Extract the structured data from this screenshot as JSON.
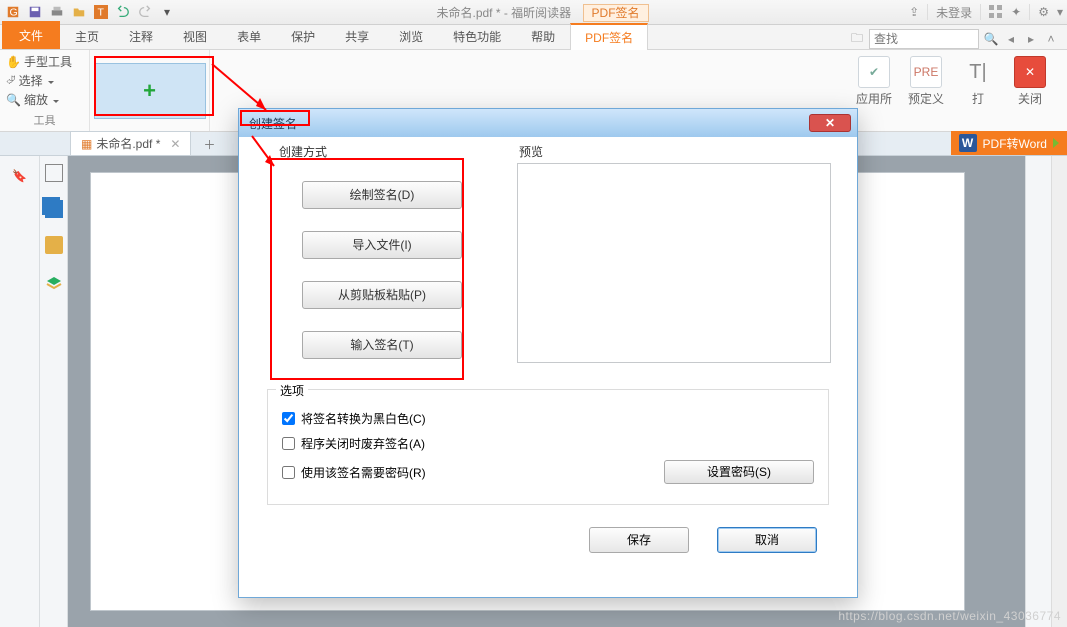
{
  "titlebar": {
    "doc_title": "未命名.pdf * - 福昕阅读器",
    "ribbon_context_label": "PDF签名",
    "login_label": "未登录"
  },
  "ribbon": {
    "file": "文件",
    "tabs": [
      "主页",
      "注释",
      "视图",
      "表单",
      "保护",
      "共享",
      "浏览",
      "特色功能",
      "帮助",
      "PDF签名"
    ],
    "search_placeholder": "查找",
    "tools_group": {
      "hand": "手型工具",
      "select": "选择",
      "zoom": "缩放",
      "group_label": "工具"
    },
    "sign_group": {
      "apply": "应用所",
      "predef": "预定义",
      "type": "打",
      "close": "关闭"
    }
  },
  "doctab": {
    "name": "未命名.pdf *",
    "pdf2word": "PDF转Word"
  },
  "dialog": {
    "title": "创建签名",
    "create_section": "创建方式",
    "preview_section": "预览",
    "btn_draw": "绘制签名(D)",
    "btn_import": "导入文件(I)",
    "btn_paste": "从剪贴板粘贴(P)",
    "btn_type": "输入签名(T)",
    "options_section": "选项",
    "opt_bw": "将签名转换为黑白色(C)",
    "opt_discard": "程序关闭时废弃签名(A)",
    "opt_password": "使用该签名需要密码(R)",
    "btn_setpw": "设置密码(S)",
    "btn_save": "保存",
    "btn_cancel": "取消"
  },
  "watermark": "https://blog.csdn.net/weixin_43036774"
}
